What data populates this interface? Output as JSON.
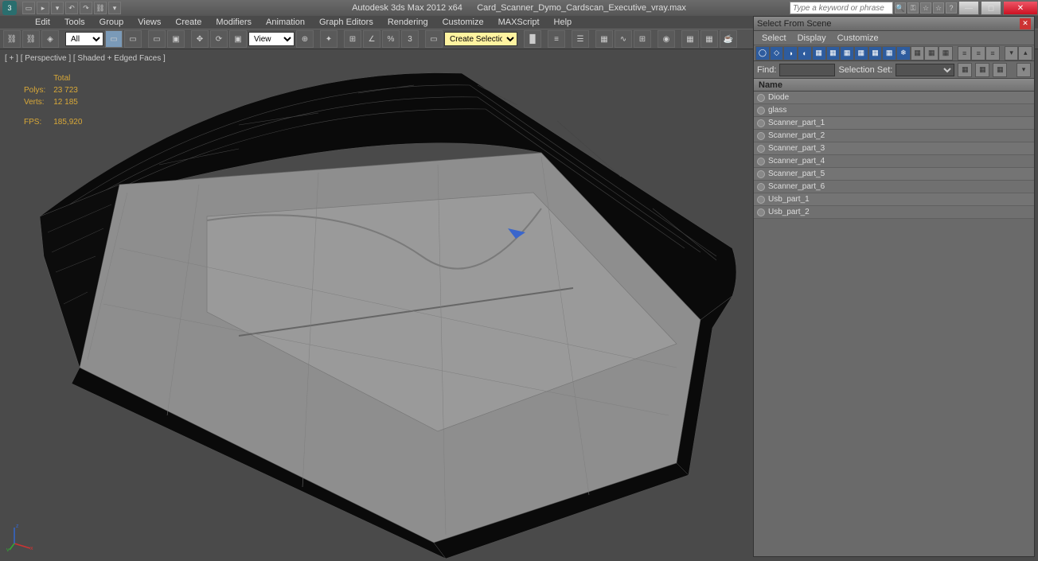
{
  "app": {
    "title_left": "Autodesk 3ds Max 2012 x64",
    "title_right": "Card_Scanner_Dymo_Cardscan_Executive_vray.max",
    "search_placeholder": "Type a keyword or phrase"
  },
  "menus": [
    "Edit",
    "Tools",
    "Group",
    "Views",
    "Create",
    "Modifiers",
    "Animation",
    "Graph Editors",
    "Rendering",
    "Customize",
    "MAXScript",
    "Help"
  ],
  "toolbar": {
    "filter_combo": "All",
    "view_combo": "View",
    "selset_combo": "Create Selection Se"
  },
  "viewport": {
    "label": "[ + ]  [ Perspective ]  [ Shaded + Edged Faces ]",
    "stats": {
      "total_label": "Total",
      "polys_label": "Polys:",
      "polys": "23 723",
      "verts_label": "Verts:",
      "verts": "12 185",
      "fps_label": "FPS:",
      "fps": "185,920"
    }
  },
  "sfs": {
    "title": "Select From Scene",
    "menus": [
      "Select",
      "Display",
      "Customize"
    ],
    "find_label": "Find:",
    "find_value": "",
    "selset_label": "Selection Set:",
    "selset_value": "",
    "name_header": "Name",
    "items": [
      {
        "name": "Diode"
      },
      {
        "name": "glass"
      },
      {
        "name": "Scanner_part_1"
      },
      {
        "name": "Scanner_part_2"
      },
      {
        "name": "Scanner_part_3"
      },
      {
        "name": "Scanner_part_4"
      },
      {
        "name": "Scanner_part_5"
      },
      {
        "name": "Scanner_part_6"
      },
      {
        "name": "Usb_part_1"
      },
      {
        "name": "Usb_part_2"
      }
    ]
  }
}
